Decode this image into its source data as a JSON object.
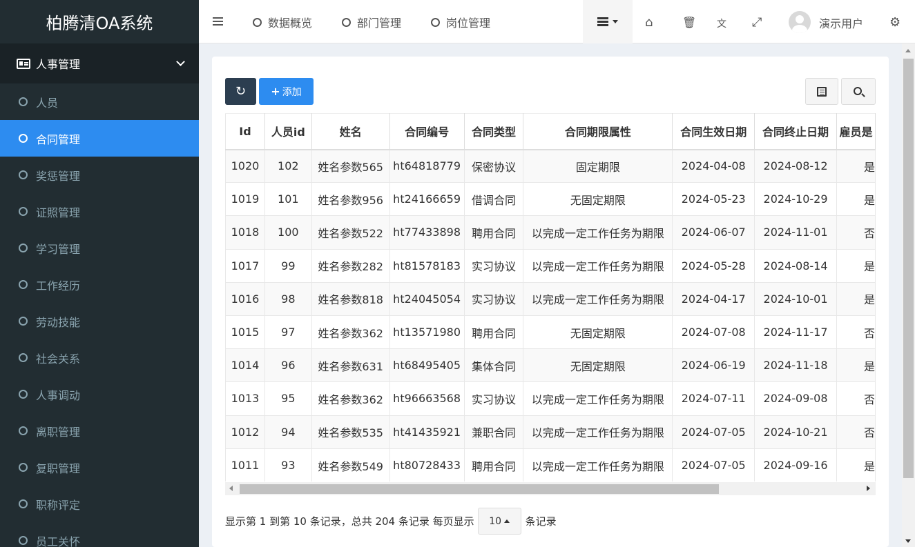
{
  "app": {
    "title": "柏腾清OA系统"
  },
  "sidebar": {
    "group_label": "人事管理",
    "items": [
      {
        "label": "人员",
        "active": false
      },
      {
        "label": "合同管理",
        "active": true
      },
      {
        "label": "奖惩管理",
        "active": false
      },
      {
        "label": "证照管理",
        "active": false
      },
      {
        "label": "学习管理",
        "active": false
      },
      {
        "label": "工作经历",
        "active": false
      },
      {
        "label": "劳动技能",
        "active": false
      },
      {
        "label": "社会关系",
        "active": false
      },
      {
        "label": "人事调动",
        "active": false
      },
      {
        "label": "离职管理",
        "active": false
      },
      {
        "label": "复职管理",
        "active": false
      },
      {
        "label": "职称评定",
        "active": false
      },
      {
        "label": "员工关怀",
        "active": false
      }
    ]
  },
  "header": {
    "tabs": [
      {
        "label": "数据概览"
      },
      {
        "label": "部门管理"
      },
      {
        "label": "岗位管理"
      }
    ],
    "icons": [
      "home-icon",
      "trash-icon",
      "translate-icon",
      "fullscreen-icon",
      "settings-icon"
    ],
    "user_name": "演示用户"
  },
  "toolbar": {
    "add_label": "添加"
  },
  "table": {
    "columns": [
      "Id",
      "人员id",
      "姓名",
      "合同编号",
      "合同类型",
      "合同期限属性",
      "合同生效日期",
      "合同终止日期",
      "雇员是"
    ],
    "rows": [
      [
        "1020",
        "102",
        "姓名参数565",
        "ht64818779",
        "保密协议",
        "固定期限",
        "2024-04-08",
        "2024-08-12",
        "是"
      ],
      [
        "1019",
        "101",
        "姓名参数956",
        "ht24166659",
        "借调合同",
        "无固定期限",
        "2024-05-23",
        "2024-10-29",
        "是"
      ],
      [
        "1018",
        "100",
        "姓名参数522",
        "ht77433898",
        "聘用合同",
        "以完成一定工作任务为期限",
        "2024-06-07",
        "2024-11-01",
        "否"
      ],
      [
        "1017",
        "99",
        "姓名参数282",
        "ht81578183",
        "实习协议",
        "以完成一定工作任务为期限",
        "2024-05-28",
        "2024-08-14",
        "是"
      ],
      [
        "1016",
        "98",
        "姓名参数818",
        "ht24045054",
        "实习协议",
        "以完成一定工作任务为期限",
        "2024-04-17",
        "2024-10-01",
        "是"
      ],
      [
        "1015",
        "97",
        "姓名参数362",
        "ht13571980",
        "聘用合同",
        "无固定期限",
        "2024-07-08",
        "2024-11-17",
        "否"
      ],
      [
        "1014",
        "96",
        "姓名参数631",
        "ht68495405",
        "集体合同",
        "无固定期限",
        "2024-06-19",
        "2024-11-18",
        "是"
      ],
      [
        "1013",
        "95",
        "姓名参数362",
        "ht96663568",
        "实习协议",
        "以完成一定工作任务为期限",
        "2024-07-11",
        "2024-09-08",
        "否"
      ],
      [
        "1012",
        "94",
        "姓名参数535",
        "ht41435921",
        "兼职合同",
        "以完成一定工作任务为期限",
        "2024-07-05",
        "2024-10-21",
        "否"
      ],
      [
        "1011",
        "93",
        "姓名参数549",
        "ht80728433",
        "聘用合同",
        "以完成一定工作任务为期限",
        "2024-07-05",
        "2024-09-16",
        "是"
      ]
    ]
  },
  "pagination": {
    "summary": "显示第 1 到第 10 条记录，总共 204 条记录 每页显示",
    "page_size": "10",
    "suffix": "条记录"
  },
  "colors": {
    "sidebar_bg": "#222d32",
    "accent": "#2d8cf0",
    "refresh_button": "#2c3e50"
  }
}
